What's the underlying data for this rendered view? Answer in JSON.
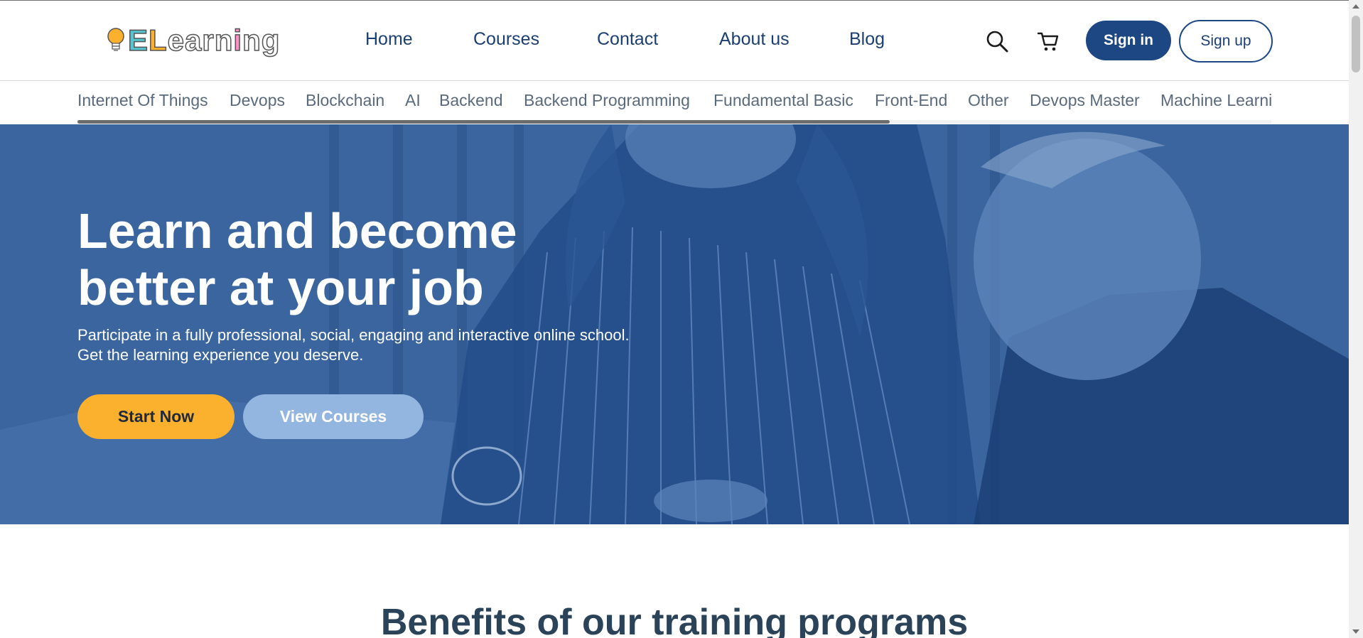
{
  "brand": {
    "logo_text": "ELearning",
    "colors": {
      "primary": "#1c4782",
      "accent": "#fbb12e",
      "hero": "#38629c",
      "secondary_button": "#93b6e0"
    }
  },
  "nav": {
    "items": [
      "Home",
      "Courses",
      "Contact",
      "About us",
      "Blog"
    ]
  },
  "header_actions": {
    "search_icon": "search-icon",
    "cart_icon": "cart-icon",
    "sign_in": "Sign in",
    "sign_up": "Sign up"
  },
  "categories": [
    "Internet Of Things",
    "Devops",
    "Blockchain",
    "AI",
    "Backend",
    "Backend Programming",
    "Fundamental Basic",
    "Front-End",
    "Other",
    "Devops Master",
    "Machine Learni"
  ],
  "hero": {
    "title_line1": "Learn and become",
    "title_line2": "better at your job",
    "subtitle_line1": "Participate in a fully professional, social, engaging and interactive online school.",
    "subtitle_line2": "Get the learning experience you deserve.",
    "primary_cta": "Start Now",
    "secondary_cta": "View Courses"
  },
  "section": {
    "benefits_title": "Benefits of our training programs"
  }
}
